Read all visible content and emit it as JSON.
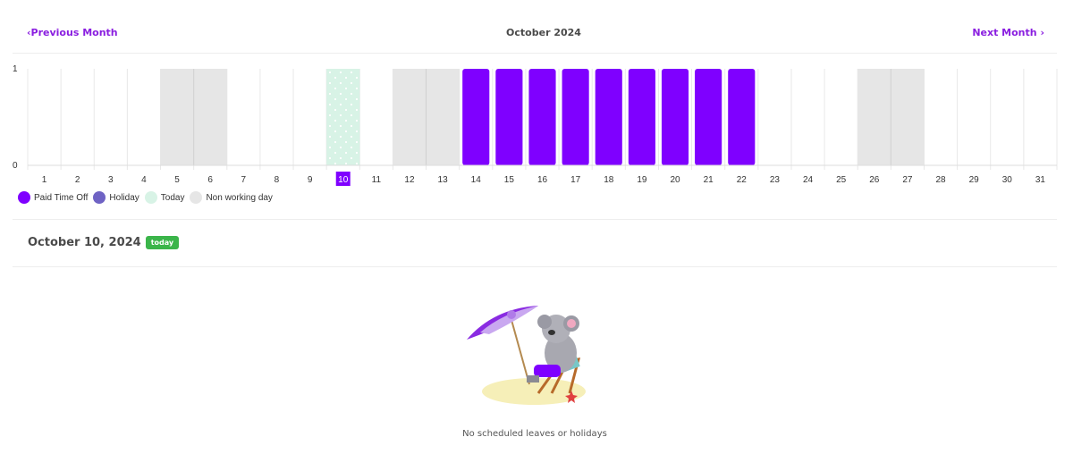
{
  "nav": {
    "prev_label": "Previous Month",
    "prev_icon": "chevron-left-icon",
    "next_label": "Next Month",
    "next_icon": "chevron-right-icon",
    "title": "October 2024"
  },
  "colors": {
    "paid_time_off": "#7f00ff",
    "holiday": "#6f63c4",
    "today": "#d8f3e6",
    "non_working_day": "#e6e6e6",
    "accent": "#8a1ee0",
    "today_badge": "#3bb54a"
  },
  "chart_data": {
    "type": "bar",
    "title": "October 2024",
    "xlabel": "",
    "ylabel": "",
    "ylim": [
      0,
      1
    ],
    "yticks": [
      "0",
      "1"
    ],
    "categories": [
      "1",
      "2",
      "3",
      "4",
      "5",
      "6",
      "7",
      "8",
      "9",
      "10",
      "11",
      "12",
      "13",
      "14",
      "15",
      "16",
      "17",
      "18",
      "19",
      "20",
      "21",
      "22",
      "23",
      "24",
      "25",
      "26",
      "27",
      "28",
      "29",
      "30",
      "31"
    ],
    "highlighted_category": "10",
    "series": [
      {
        "name": "Paid Time Off",
        "values": [
          0,
          0,
          0,
          0,
          0,
          0,
          0,
          0,
          0,
          0,
          0,
          0,
          0,
          1,
          1,
          1,
          1,
          1,
          1,
          1,
          1,
          1,
          0,
          0,
          0,
          0,
          0,
          0,
          0,
          0,
          0
        ]
      },
      {
        "name": "Holiday",
        "values": [
          0,
          0,
          0,
          0,
          0,
          0,
          0,
          0,
          0,
          0,
          0,
          0,
          0,
          0,
          0,
          0,
          0,
          0,
          0,
          0,
          0,
          0,
          0,
          0,
          0,
          0,
          0,
          0,
          0,
          0,
          0
        ]
      },
      {
        "name": "Today",
        "values": [
          0,
          0,
          0,
          0,
          0,
          0,
          0,
          0,
          0,
          1,
          0,
          0,
          0,
          0,
          0,
          0,
          0,
          0,
          0,
          0,
          0,
          0,
          0,
          0,
          0,
          0,
          0,
          0,
          0,
          0,
          0
        ]
      },
      {
        "name": "Non working day",
        "values": [
          0,
          0,
          0,
          0,
          1,
          1,
          0,
          0,
          0,
          0,
          0,
          1,
          1,
          0,
          0,
          0,
          0,
          0,
          0,
          0,
          0,
          0,
          0,
          0,
          0,
          1,
          1,
          0,
          0,
          0,
          0
        ]
      }
    ],
    "grid": true,
    "legend": "bottom-left"
  },
  "legend": [
    {
      "label": "Paid Time Off",
      "color": "#7f00ff"
    },
    {
      "label": "Holiday",
      "color": "#6f63c4"
    },
    {
      "label": "Today",
      "color": "#d8f3e6"
    },
    {
      "label": "Non working day",
      "color": "#e6e6e6"
    }
  ],
  "detail": {
    "date_title": "October 10, 2024",
    "badge": "today",
    "empty_message": "No scheduled leaves or holidays",
    "illustration": "koala-beach-chair-illustration"
  }
}
